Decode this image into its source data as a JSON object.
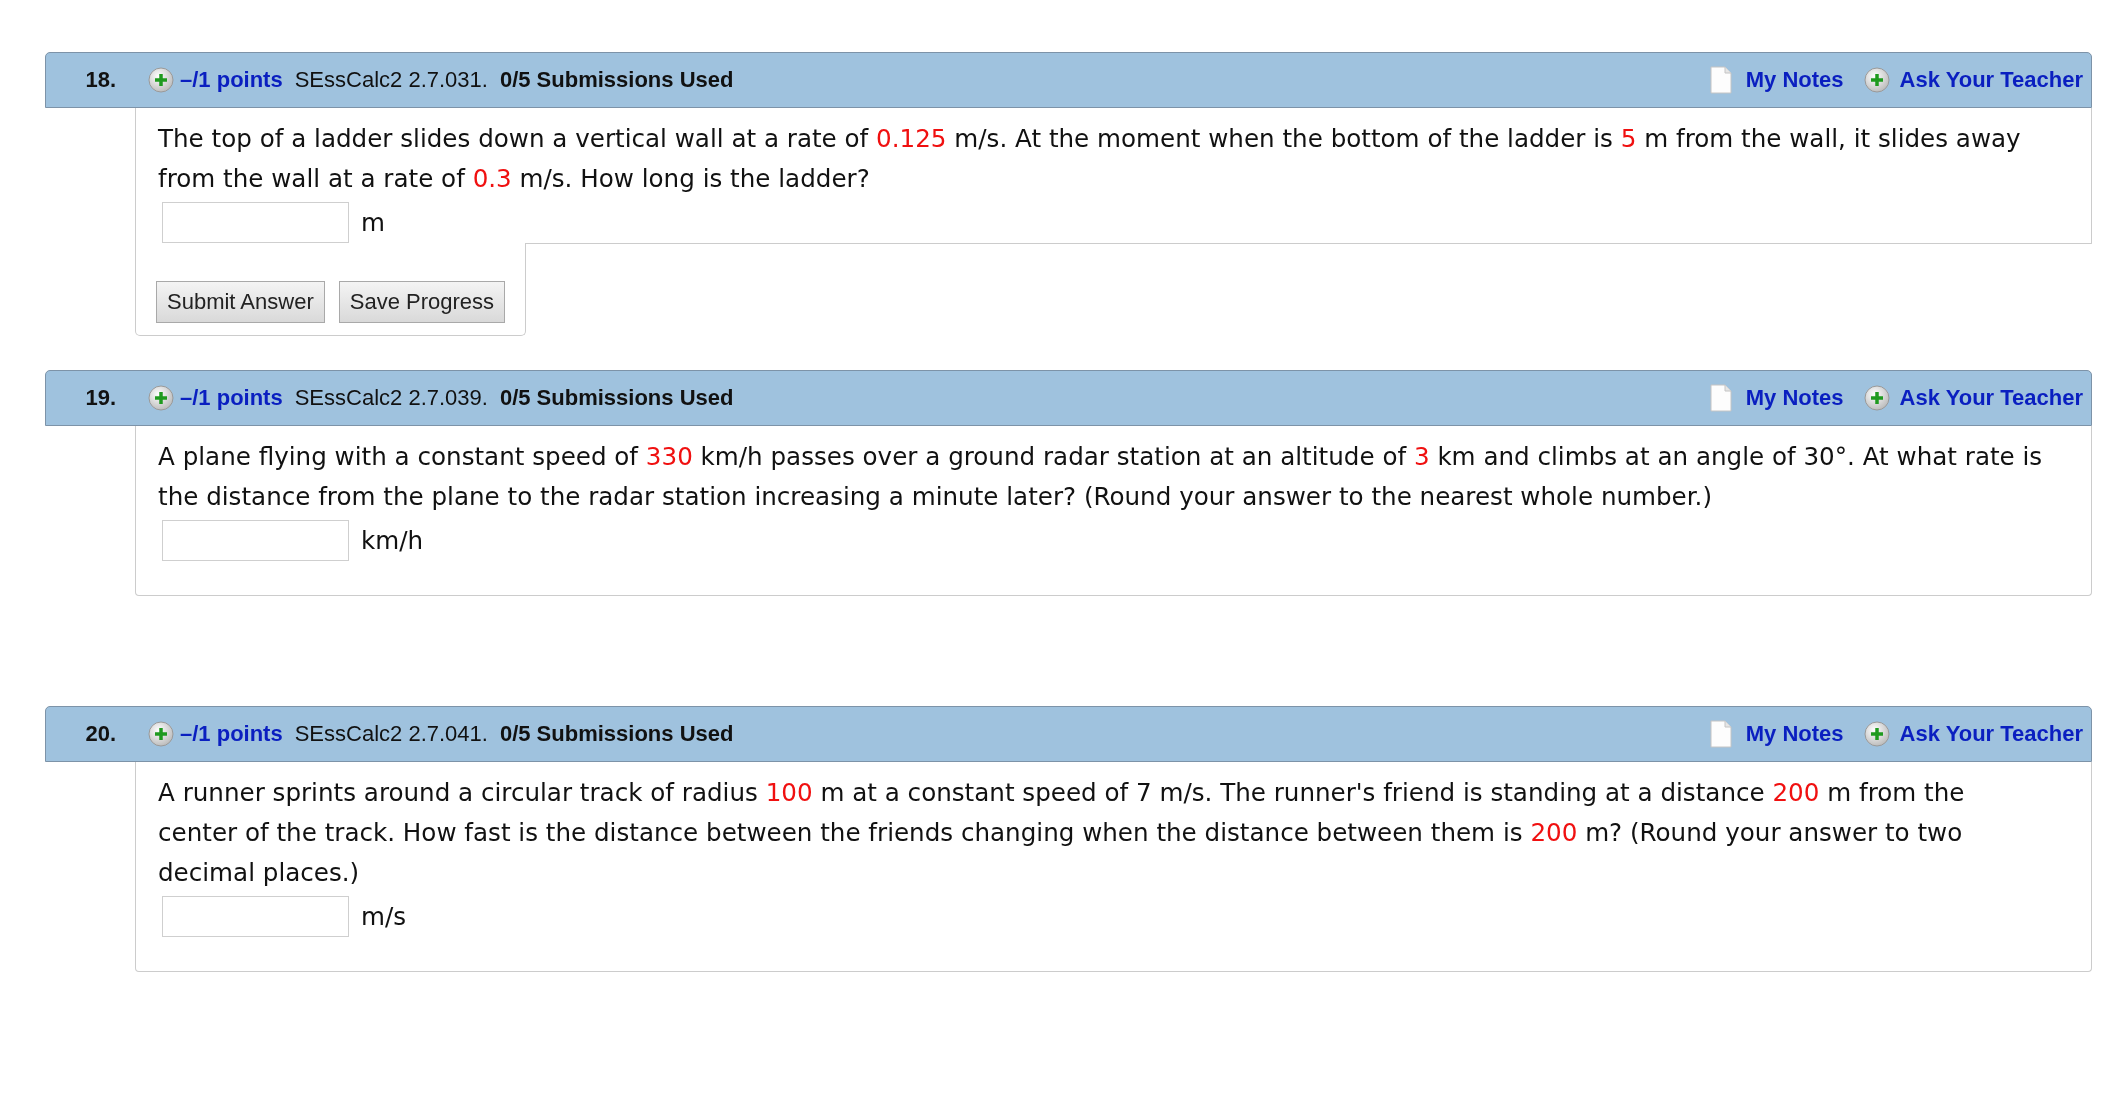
{
  "questions": [
    {
      "number": "18.",
      "points": "–/1 points",
      "source": "SEssCalc2 2.7.031.",
      "submissions": "0/5 Submissions Used",
      "notes_link": "My Notes",
      "ask_link": "Ask Your Teacher",
      "text": [
        {
          "kind": "plain",
          "text": "The top of a ladder slides down a vertical wall at a rate of "
        },
        {
          "kind": "value",
          "text": "0.125"
        },
        {
          "kind": "plain",
          "text": " m/s. At the moment when the bottom of the ladder is "
        },
        {
          "kind": "value",
          "text": "5"
        },
        {
          "kind": "plain",
          "text": " m from the wall, it slides away from the wall at a rate of "
        },
        {
          "kind": "value",
          "text": "0.3"
        },
        {
          "kind": "plain",
          "text": " m/s. How long is the ladder?"
        }
      ],
      "unit": "m",
      "buttons": [
        "Submit Answer",
        "Save Progress"
      ]
    },
    {
      "number": "19.",
      "points": "–/1 points",
      "source": "SEssCalc2 2.7.039.",
      "submissions": "0/5 Submissions Used",
      "notes_link": "My Notes",
      "ask_link": "Ask Your Teacher",
      "text": [
        {
          "kind": "plain",
          "text": "A plane flying with a constant speed of "
        },
        {
          "kind": "value",
          "text": "330"
        },
        {
          "kind": "plain",
          "text": " km/h passes over a ground radar station at an altitude of "
        },
        {
          "kind": "value",
          "text": "3"
        },
        {
          "kind": "plain",
          "text": " km and climbs at an angle of 30°. At what rate is the distance from the plane to the radar station increasing a minute later? (Round your answer to the nearest whole number.)"
        }
      ],
      "unit": "km/h"
    },
    {
      "number": "20.",
      "points": "–/1 points",
      "source": "SEssCalc2 2.7.041.",
      "submissions": "0/5 Submissions Used",
      "notes_link": "My Notes",
      "ask_link": "Ask Your Teacher",
      "text": [
        {
          "kind": "plain",
          "text": "A runner sprints around a circular track of radius "
        },
        {
          "kind": "value",
          "text": "100"
        },
        {
          "kind": "plain",
          "text": " m at a constant speed of 7 m/s. The runner's friend is standing at a distance "
        },
        {
          "kind": "value",
          "text": "200"
        },
        {
          "kind": "plain",
          "text": " m from the center of the track. How fast is the distance between the friends changing when the distance between them is "
        },
        {
          "kind": "value",
          "text": "200"
        },
        {
          "kind": "plain",
          "text": " m? (Round your answer to two decimal places.)"
        }
      ],
      "unit": "m/s"
    }
  ]
}
